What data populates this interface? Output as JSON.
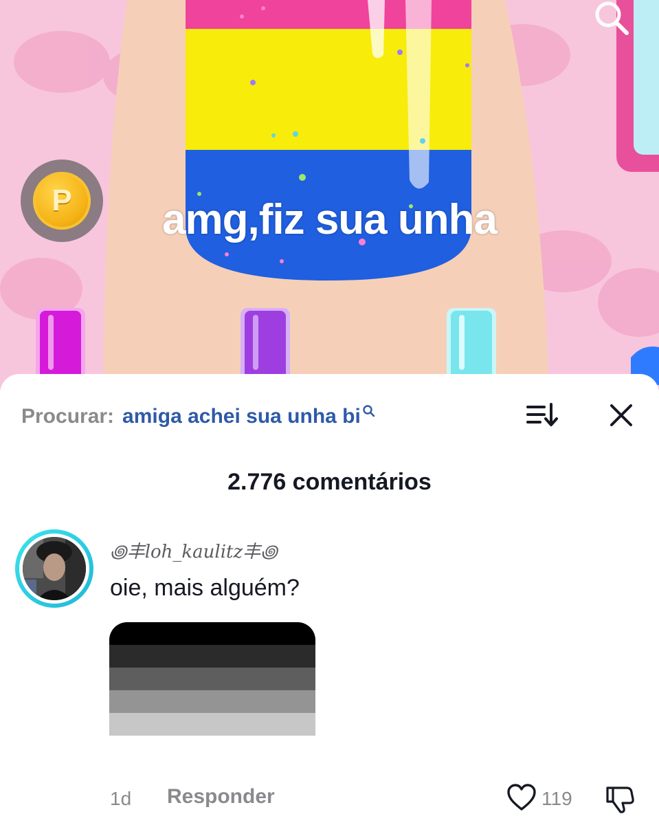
{
  "video": {
    "caption": "amg,fiz sua unha",
    "coin_letter": "P",
    "search_icon": "search-icon",
    "colors": {
      "background": "#f7c6dc",
      "nail_pink": "#f0439b",
      "nail_yellow": "#f8ec0a",
      "nail_blue": "#1f5fe0",
      "polish_magenta": "#d61ad9",
      "polish_purple": "#9f3ee0",
      "polish_cyan": "#78e6ec"
    }
  },
  "comments_panel": {
    "search_label": "Procurar:",
    "search_query": "amiga achei sua unha bi",
    "sort_icon": "sort-icon",
    "close_icon": "close-icon",
    "count_label": "2.776 comentários",
    "comment": {
      "username": "꩜丰loh_kaulitz丰꩜",
      "text": "oie, mais alguém?",
      "image_stripes": [
        "#000000",
        "#2b2b2b",
        "#5e5e5e",
        "#949494",
        "#c7c7c7",
        "#ffffff"
      ],
      "time": "1d",
      "reply_label": "Responder",
      "like_count": "119",
      "like_icon": "heart-icon",
      "dislike_icon": "dislike-icon"
    }
  }
}
